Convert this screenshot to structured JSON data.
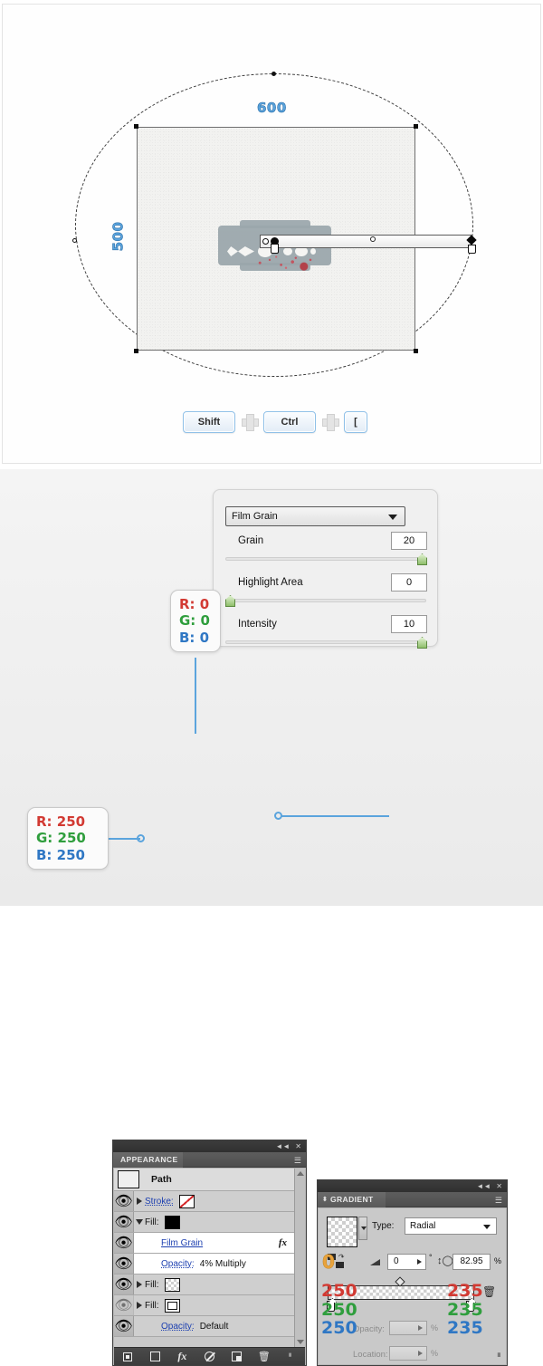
{
  "canvas": {
    "dimension_width_label": "600",
    "dimension_height_label": "500",
    "shortcut_keys": [
      {
        "label": "Shift"
      },
      {
        "label": "Ctrl"
      },
      {
        "label": "["
      }
    ],
    "plus_separator": "plus-icon"
  },
  "film_grain_dialog": {
    "effect_name": "Film Grain",
    "rows": [
      {
        "label": "Grain",
        "value": "20",
        "thumb": "right"
      },
      {
        "label": "Highlight Area",
        "value": "0",
        "thumb": "left"
      },
      {
        "label": "Intensity",
        "value": "10",
        "thumb": "right"
      }
    ]
  },
  "callouts": {
    "black": {
      "r": "R: 0",
      "g": "G: 0",
      "b": "B: 0"
    },
    "white": {
      "r": "R: 250",
      "g": "G: 250",
      "b": "B: 250"
    }
  },
  "appearance_panel": {
    "tab_label": "APPEARANCE",
    "object_label": "Path",
    "rows": [
      {
        "label": "Stroke:",
        "swatch": "none",
        "triangle": "right",
        "eye": "on"
      },
      {
        "label": "Fill:",
        "swatch": "black",
        "triangle": "down",
        "eye": "on"
      },
      {
        "label": "Film Grain",
        "fx": "fx",
        "eye": "on"
      },
      {
        "label": "Opacity:",
        "value": "4% Multiply",
        "eye": "on"
      },
      {
        "label": "Fill:",
        "swatch": "checker",
        "triangle": "right",
        "eye": "on"
      },
      {
        "label": "Fill:",
        "swatch": "whitefill",
        "triangle": "right",
        "eye": "off"
      },
      {
        "label": "Opacity:",
        "value": "Default",
        "eye": "on"
      }
    ],
    "footer_buttons": [
      {
        "name": "new-art-basic-appearance"
      },
      {
        "name": "clear-appearance"
      },
      {
        "name": "add-effect"
      },
      {
        "name": "delete-effect"
      },
      {
        "name": "duplicate-item"
      },
      {
        "name": "delete-item"
      }
    ]
  },
  "gradient_panel": {
    "tab_label": "GRADIENT",
    "type_label": "Type:",
    "type_value": "Radial",
    "angle_value": "0",
    "degree_symbol": "°",
    "aspect_value": "82.95",
    "percent_symbol": "%",
    "reverse_overlay_value": "0",
    "opacity_label": "Opacity:",
    "opacity_value": "",
    "opacity_percent": "%",
    "location_label": "Location:",
    "location_value": "",
    "location_percent": "%",
    "stop_left_rgb": {
      "r": "250",
      "g": "250",
      "b": "250"
    },
    "stop_right_rgb": {
      "r": "235",
      "g": "235",
      "b": "235"
    }
  }
}
